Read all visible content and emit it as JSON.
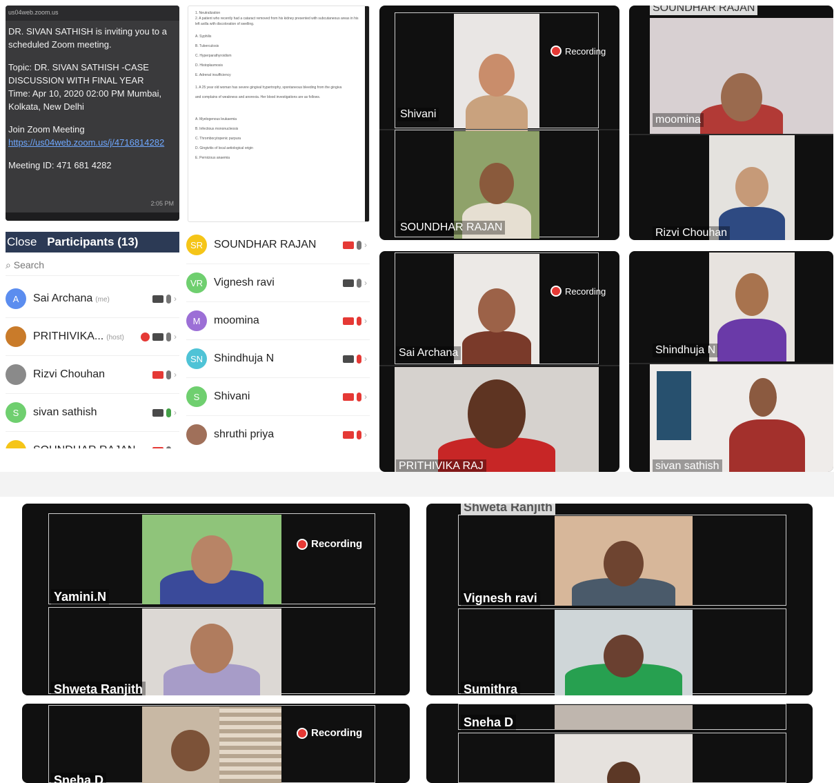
{
  "invite": {
    "header": "us04web.zoom.us",
    "line1": "DR. SIVAN SATHISH is inviting you to a scheduled Zoom meeting.",
    "topic": "Topic: DR. SIVAN SATHISH -CASE DISCUSSION WITH FINAL YEAR",
    "time": "Time: Apr 10, 2020 02:00 PM Mumbai, Kolkata, New Delhi",
    "join_label": "Join Zoom Meeting",
    "link": "https://us04web.zoom.us/j/4716814282",
    "meeting_id": "Meeting ID: 471 681 4282",
    "timestamp": "2:05 PM"
  },
  "document": {
    "q1": "1. Neutralization",
    "q1_text": "2. A patient who recently had a cataract removed from his kidney presented with subcutaneous areas in his left axilla with discoloration of swelling.",
    "q2": "1. A 25 year old woman has severe gingival hypertrophy, spontaneous bleeding from the gingiva",
    "q2_text": "and complains of weakness and anorexia. Her blood investigations are as follows.",
    "options_a": [
      "A. Syphilis",
      "B. Tuberculosis",
      "C. Hyperparathyroidism",
      "D. Histoplasmosis",
      "E. Adrenal insufficiency"
    ],
    "options_b": [
      "A. Myelogenous leukaemia",
      "B. Infectious mononucleosis",
      "C. Thrombocytopenic purpura",
      "D. Gingivitis of local aetiological origin",
      "E. Pernicious anaemia"
    ]
  },
  "participants": {
    "close_label": "Close",
    "title": "Participants (13)",
    "search_placeholder": "Search",
    "left": [
      {
        "initials": "A",
        "name": "Sai Archana",
        "tag": "(me)",
        "color": "#5b8def",
        "cam": "on",
        "mic": "muted-gray"
      },
      {
        "initials": "",
        "name": "PRITHIVIKA...",
        "tag": "(host)",
        "color": "#c97b2a",
        "cam": "on",
        "mic": "muted-gray",
        "rec": true
      },
      {
        "initials": "",
        "name": "Rizvi Chouhan",
        "tag": "",
        "color": "#8a8a8a",
        "cam": "off",
        "mic": "muted-gray"
      },
      {
        "initials": "S",
        "name": "sivan sathish",
        "tag": "",
        "color": "#6fcf6f",
        "cam": "on",
        "mic": "on"
      },
      {
        "initials": "",
        "name": "SOUNDHAR RAJAN",
        "tag": "",
        "color": "#f5c518",
        "cam": "off",
        "mic": "muted-gray"
      }
    ],
    "right": [
      {
        "initials": "SR",
        "name": "SOUNDHAR RAJAN",
        "color": "#f5c518",
        "cam": "off",
        "mic": "muted-gray"
      },
      {
        "initials": "VR",
        "name": "Vignesh ravi",
        "color": "#6fcf6f",
        "cam": "on",
        "mic": "muted-gray"
      },
      {
        "initials": "M",
        "name": "moomina",
        "color": "#9c6fd6",
        "cam": "off",
        "mic": "off"
      },
      {
        "initials": "SN",
        "name": "Shindhuja N",
        "color": "#4fc3d6",
        "cam": "on",
        "mic": "off"
      },
      {
        "initials": "S",
        "name": "Shivani",
        "color": "#6fcf6f",
        "cam": "off",
        "mic": "off"
      },
      {
        "initials": "",
        "name": "shruthi priya",
        "color": "#a0705a",
        "cam": "off",
        "mic": "off"
      }
    ]
  },
  "recording_label": "Recording",
  "tiles": {
    "t1_top": "Shivani",
    "t1_bottom": "SOUNDHAR RAJAN",
    "t2_topcut": "SOUNDHAR RAJAN",
    "t2_top": "moomina",
    "t2_bottom": "Rizvi Chouhan",
    "t3_top": "Sai Archana",
    "t3_bottom": "PRITHIVIKA RAJ",
    "t4_top": "Shindhuja N",
    "t4_bottom": "sivan sathish",
    "b1_top": "Yamini.N",
    "b1_bottom": "Shweta Ranjith",
    "b2_topcut": "Shweta Ranjith",
    "b2_top": "Vignesh ravi",
    "b2_bottom": "Sumithra",
    "b3_bottom": "Sneha D",
    "b4_top": "Sneha D"
  }
}
